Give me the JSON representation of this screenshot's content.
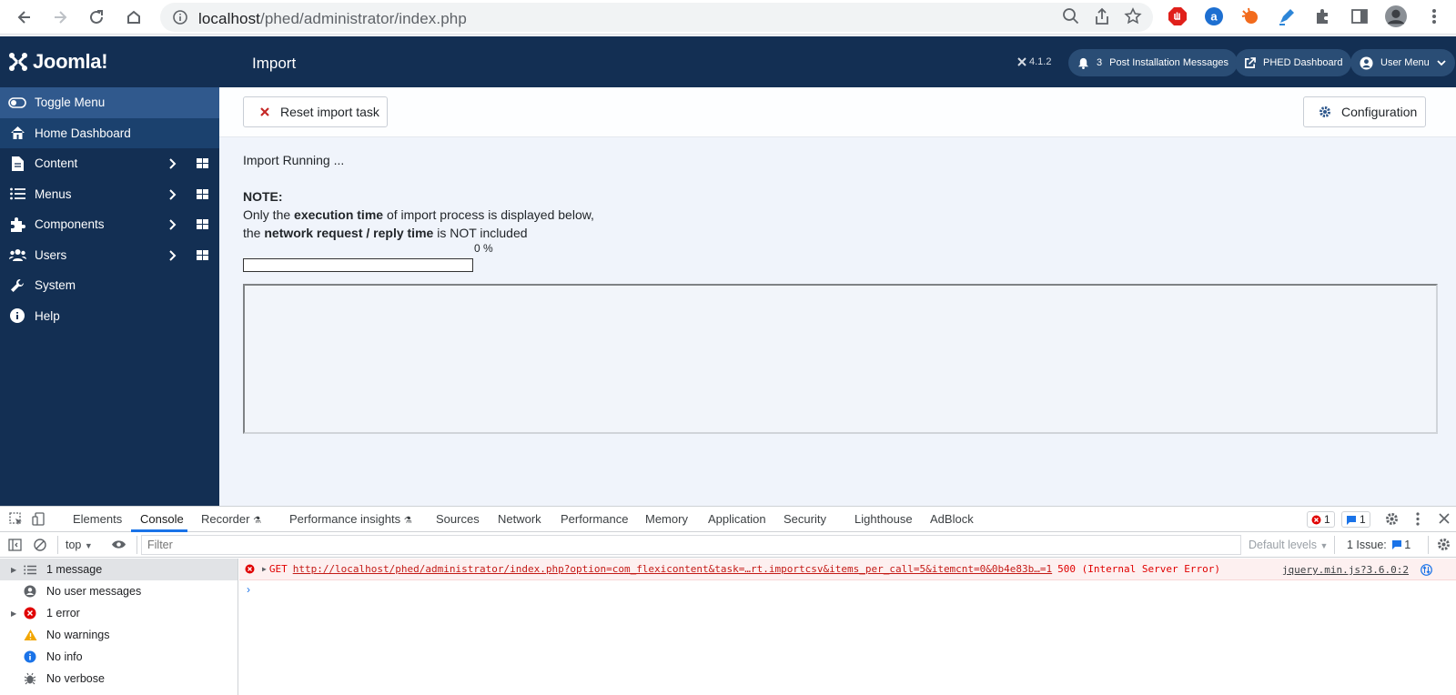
{
  "browser": {
    "url_host": "localhost",
    "url_path": "/phed/administrator/index.php"
  },
  "header": {
    "logo_text": "Joomla!",
    "title": "Import",
    "version": "4.1.2",
    "post_install_count": "3",
    "post_install_label": "Post Installation Messages",
    "dashboard_label": "PHED Dashboard",
    "user_menu_label": "User Menu"
  },
  "sidebar": {
    "items": [
      {
        "label": "Toggle Menu"
      },
      {
        "label": "Home Dashboard"
      },
      {
        "label": "Content"
      },
      {
        "label": "Menus"
      },
      {
        "label": "Components"
      },
      {
        "label": "Users"
      },
      {
        "label": "System"
      },
      {
        "label": "Help"
      }
    ]
  },
  "toolbar": {
    "reset_label": "Reset import task",
    "config_label": "Configuration"
  },
  "main": {
    "status": "Import Running ...",
    "note_title": "NOTE:",
    "line1_pre": "Only the ",
    "line1_bold": "execution time",
    "line1_post": " of import process is displayed below,",
    "line2_pre": "the ",
    "line2_bold": "network request / reply time",
    "line2_post": " is NOT included",
    "progress_label": "0 %",
    "progress_value": 0
  },
  "devtools": {
    "tabs": [
      "Elements",
      "Console",
      "Recorder",
      "Performance insights",
      "Sources",
      "Network",
      "Performance",
      "Memory",
      "Application",
      "Security",
      "Lighthouse",
      "AdBlock"
    ],
    "error_count": "1",
    "message_count": "1",
    "context": "top",
    "filter_placeholder": "Filter",
    "default_levels": "Default levels",
    "issues_label": "1 Issue:",
    "issues_count": "1",
    "side": [
      {
        "label": "1 message"
      },
      {
        "label": "No user messages"
      },
      {
        "label": "1 error"
      },
      {
        "label": "No warnings"
      },
      {
        "label": "No info"
      },
      {
        "label": "No verbose"
      }
    ],
    "error": {
      "method": "GET",
      "url": "http://localhost/phed/administrator/index.php?option=com_flexicontent&task=…rt.importcsv&items_per_call=5&itemcnt=0&0b4e83b…=1",
      "status": "500 (Internal Server Error)",
      "source": "jquery.min.js?3.6.0:2"
    }
  },
  "colors": {
    "joomla_navy": "#132f53",
    "sidebar_active": "#30598d",
    "error_red": "#e00000",
    "devtools_blue": "#1a73e8"
  }
}
